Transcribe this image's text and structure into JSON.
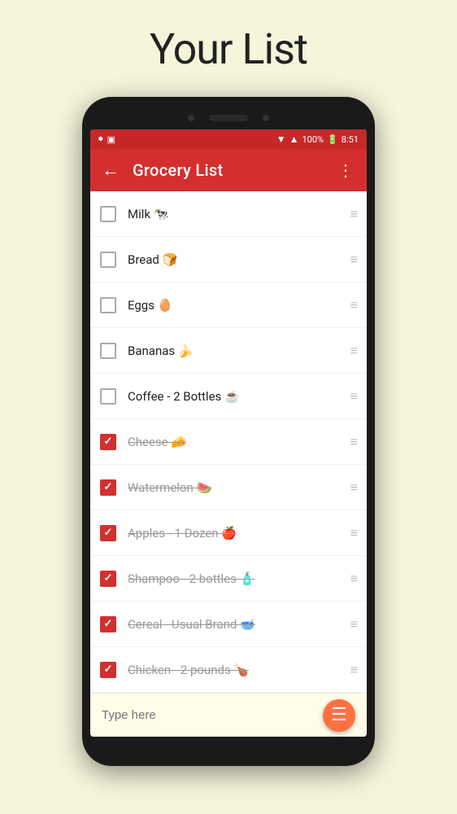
{
  "page": {
    "title": "Your List"
  },
  "statusBar": {
    "battery": "100%",
    "time": "8:51"
  },
  "appBar": {
    "backIcon": "←",
    "title": "Grocery List",
    "menuIcon": "⋮"
  },
  "items": [
    {
      "id": 1,
      "text": "Milk 🐄",
      "checked": false
    },
    {
      "id": 2,
      "text": "Bread 🍞",
      "checked": false
    },
    {
      "id": 3,
      "text": "Eggs 🥚",
      "checked": false
    },
    {
      "id": 4,
      "text": "Bananas 🍌",
      "checked": false
    },
    {
      "id": 5,
      "text": "Coffee - 2 Bottles ☕",
      "checked": false
    },
    {
      "id": 6,
      "text": "Cheese 🧀",
      "checked": true
    },
    {
      "id": 7,
      "text": "Watermelon 🍉",
      "checked": true
    },
    {
      "id": 8,
      "text": "Apples - 1 Dozen 🍎",
      "checked": true
    },
    {
      "id": 9,
      "text": "Shampoo - 2 bottles 🧴",
      "checked": true
    },
    {
      "id": 10,
      "text": "Cereal - Usual Brand 🥣",
      "checked": true
    },
    {
      "id": 11,
      "text": "Chicken - 2 pounds 🍗",
      "checked": true
    }
  ],
  "inputBar": {
    "placeholder": "Type here",
    "fabIcon": "≡"
  },
  "colors": {
    "appBarRed": "#d32f2f",
    "statusBarRed": "#c62828",
    "fabOrange": "#ff7043",
    "inputBarYellow": "#fffde7"
  }
}
